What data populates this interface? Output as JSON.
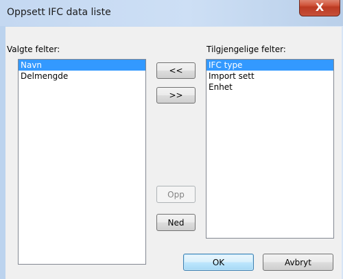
{
  "window": {
    "title": "Oppsett IFC data liste",
    "close_glyph": "X"
  },
  "left_panel": {
    "label": "Valgte felter:",
    "items": [
      "Navn",
      "Delmengde"
    ],
    "selected_index": 0
  },
  "right_panel": {
    "label": "Tilgjengelige felter:",
    "items": [
      "IFC type",
      "Import sett",
      "Enhet"
    ],
    "selected_index": 0
  },
  "buttons": {
    "move_left": "<<",
    "move_right": ">>",
    "up": "Opp",
    "down": "Ned",
    "ok": "OK",
    "cancel": "Avbryt"
  },
  "colors": {
    "selection": "#3399ff",
    "close_button": "#c6503a",
    "dialog_bg": "#f0f0f0"
  }
}
